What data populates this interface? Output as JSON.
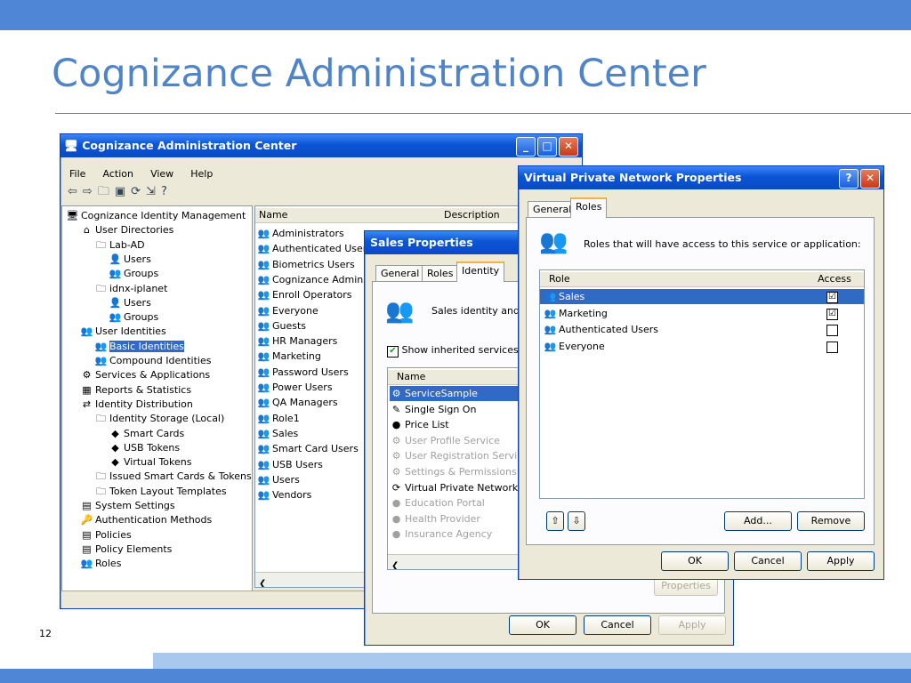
{
  "slide": {
    "title": "Cognizance Administration Center",
    "page_number": "12"
  },
  "main_window": {
    "title": "Cognizance Administration Center",
    "menu": [
      "File",
      "Action",
      "View",
      "Help"
    ],
    "tree": [
      "Cognizance Identity Management",
      "User Directories",
      "Lab-AD",
      "Users",
      "Groups",
      "idnx-iplanet",
      "Users",
      "Groups",
      "User Identities",
      "Basic Identities",
      "Compound Identities",
      "Services & Applications",
      "Reports & Statistics",
      "Identity Distribution",
      "Identity Storage (Local)",
      "Smart Cards",
      "USB Tokens",
      "Virtual Tokens",
      "Issued Smart Cards & Tokens",
      "Token Layout Templates",
      "System Settings",
      "Authentication Methods",
      "Policies",
      "Policy Elements",
      "Roles"
    ],
    "list_headers": [
      "Name",
      "Description"
    ],
    "list_items": [
      "Administrators",
      "Authenticated Users",
      "Biometrics Users",
      "Cognizance Admins",
      "Enroll Operators",
      "Everyone",
      "Guests",
      "HR Managers",
      "Marketing",
      "Password Users",
      "Power Users",
      "QA Managers",
      "Role1",
      "Sales",
      "Smart Card Users",
      "USB Users",
      "Users",
      "Vendors"
    ]
  },
  "sales_dialog": {
    "title": "Sales Properties",
    "tabs": [
      "General",
      "Roles",
      "Identity"
    ],
    "description": "Sales identity and av",
    "checkbox_label": "Show inherited services an",
    "list_header": "Name",
    "services": [
      "ServiceSample",
      "Single Sign On",
      "Price List",
      "User Profile Service",
      "User Registration Service",
      "Settings & Permissions Se",
      "Virtual Private Network",
      "Education Portal",
      "Health Provider",
      "Insurance Agency"
    ],
    "properties_label": "Properties",
    "ok": "OK",
    "cancel": "Cancel",
    "apply": "Apply"
  },
  "vpn_dialog": {
    "title": "Virtual Private Network Properties",
    "tabs": [
      "General",
      "Roles"
    ],
    "description": "Roles that will have access to this service or application:",
    "headers": [
      "Role",
      "Access"
    ],
    "roles": [
      {
        "name": "Sales",
        "access": "☑"
      },
      {
        "name": "Marketing",
        "access": "☑"
      },
      {
        "name": "Authenticated Users",
        "access": ""
      },
      {
        "name": "Everyone",
        "access": ""
      }
    ],
    "add": "Add...",
    "remove": "Remove",
    "ok": "OK",
    "cancel": "Cancel",
    "apply": "Apply"
  }
}
